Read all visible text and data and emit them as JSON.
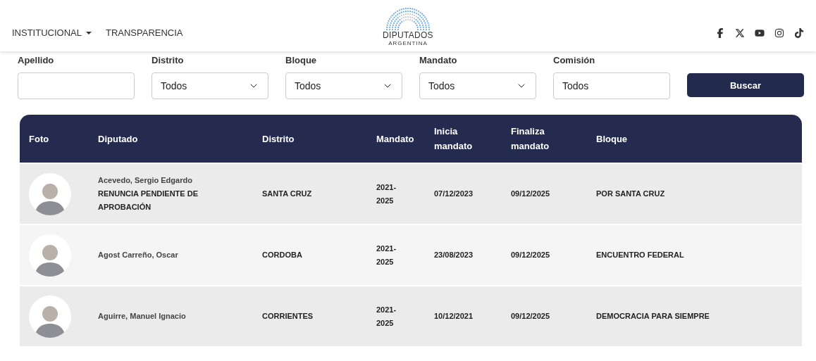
{
  "nav": {
    "items": [
      {
        "label": "INSTITUCIONAL",
        "dropdown": true
      },
      {
        "label": "TRANSPARENCIA",
        "dropdown": false
      }
    ]
  },
  "logo": {
    "title": "DIPUTADOS",
    "subtitle": "ARGENTINA"
  },
  "filters": [
    {
      "label": "Apellido",
      "kind": "text"
    },
    {
      "label": "Distrito",
      "kind": "select",
      "value": "Todos"
    },
    {
      "label": "Bloque",
      "kind": "select",
      "value": "Todos"
    },
    {
      "label": "Mandato",
      "kind": "select",
      "value": "Todos"
    },
    {
      "label": "Comisión",
      "kind": "text",
      "value": "Todos"
    }
  ],
  "search_button": "Buscar",
  "table": {
    "columns": [
      "Foto",
      "Diputado",
      "Distrito",
      "Mandato",
      "Inicia mandato",
      "Finaliza mandato",
      "Bloque"
    ],
    "rows": [
      {
        "name": "Acevedo, Sergio Edgardo",
        "status": "RENUNCIA PENDIENTE DE APROBACIÓN",
        "district": "SANTA CRUZ",
        "term": "2021-2025",
        "start": "07/12/2023",
        "end": "09/12/2025",
        "bloc": "POR SANTA CRUZ"
      },
      {
        "name": "Agost Carreño, Oscar",
        "district": "CORDOBA",
        "term": "2021-2025",
        "start": "23/08/2023",
        "end": "09/12/2025",
        "bloc": "ENCUENTRO FEDERAL"
      },
      {
        "name": "Aguirre, Manuel Ignacio",
        "district": "CORRIENTES",
        "term": "2021-2025",
        "start": "10/12/2021",
        "end": "09/12/2025",
        "bloc": "DEMOCRACIA PARA SIEMPRE"
      }
    ]
  }
}
